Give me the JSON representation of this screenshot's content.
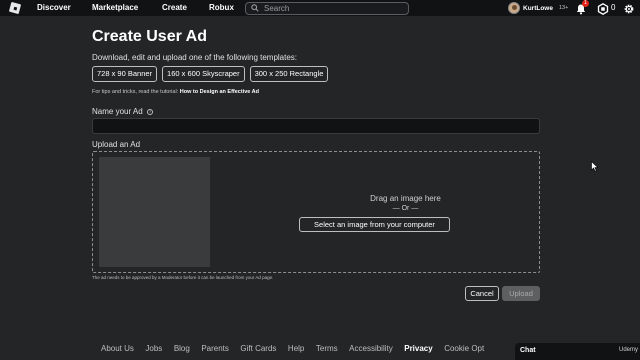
{
  "nav": {
    "links": [
      "Discover",
      "Marketplace",
      "Create",
      "Robux"
    ],
    "search_placeholder": "Search",
    "username": "KurtLowe",
    "age_label": "13+",
    "notification_count": "1",
    "robux_count": "0"
  },
  "page": {
    "title": "Create User Ad",
    "subtitle": "Download, edit and upload one of the following templates:",
    "templates": [
      "728 x 90 Banner",
      "160 x 600 Skyscraper",
      "300 x 250 Rectangle"
    ],
    "tips_prefix": "For tips and tricks, read the tutorial:",
    "tips_link": "How to Design an Effective Ad",
    "name_label": "Name your Ad",
    "name_value": "",
    "upload_label": "Upload an Ad",
    "drag_text": "Drag an image here",
    "or_text": "— Or —",
    "select_button": "Select an image from your computer",
    "approval_note": "The ad needs to be approved by a Moderator before it can be launched from your Ad page.",
    "cancel_button": "Cancel",
    "upload_button": "Upload"
  },
  "footer": {
    "links": [
      "About Us",
      "Jobs",
      "Blog",
      "Parents",
      "Gift Cards",
      "Help",
      "Terms",
      "Accessibility",
      "Privacy",
      "Cookie Opt"
    ]
  },
  "chat": {
    "label": "Chat",
    "watermark": "Udemy"
  },
  "colors": {
    "background": "#232527",
    "topbar": "#111214",
    "input_bg": "#111214",
    "preview_bg": "#393b3d",
    "notification_badge": "#e2231a",
    "disabled_button": "#5d5f61"
  }
}
